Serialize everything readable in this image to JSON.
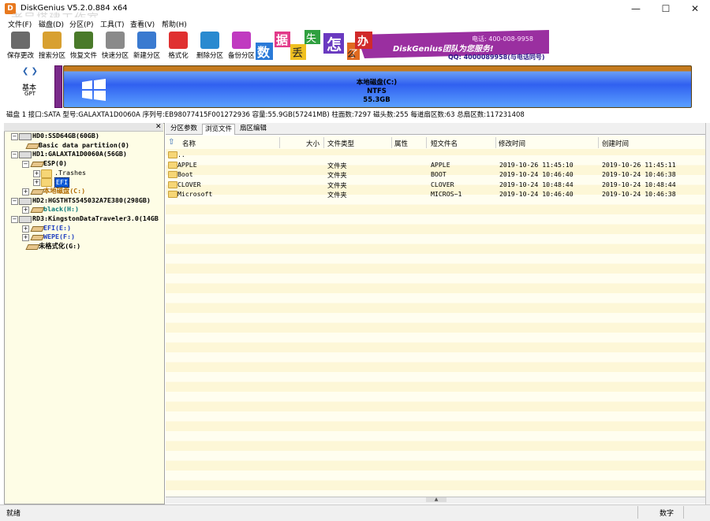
{
  "window": {
    "title": "DiskGenius V5.2.0.884 x64",
    "app_icon_letter": "D",
    "watermark": "老吴搭建工作室"
  },
  "menu": [
    "文件(F)",
    "磁盘(D)",
    "分区(P)",
    "工具(T)",
    "查看(V)",
    "帮助(H)"
  ],
  "toolbar": [
    {
      "label": "保存更改",
      "icon": "save-icon"
    },
    {
      "label": "搜索分区",
      "icon": "search-icon"
    },
    {
      "label": "恢复文件",
      "icon": "recover-icon"
    },
    {
      "label": "快速分区",
      "icon": "quick-partition-icon"
    },
    {
      "label": "新建分区",
      "icon": "new-partition-icon"
    },
    {
      "label": "格式化",
      "icon": "format-icon"
    },
    {
      "label": "删除分区",
      "icon": "delete-icon"
    },
    {
      "label": "备份分区",
      "icon": "backup-icon"
    }
  ],
  "banner": {
    "chars": [
      "数",
      "据",
      "丢",
      "失",
      "了",
      "怎",
      "么",
      "办"
    ],
    "brand": "DiskGenius团队为您服务!",
    "phone": "电话: 400-008-9958",
    "qq": "QQ: 4000089958(与电话同号)"
  },
  "diskmap": {
    "type_label": "基本",
    "scheme": "GPT",
    "partition_name": "本地磁盘(C:)",
    "filesystem": "NTFS",
    "size": "55.3GB"
  },
  "disk_info": "磁盘 1 接口:SATA  型号:GALAXTA1D0060A  序列号:EB98077415F001272936  容量:55.9GB(57241MB)  柱面数:7297  磁头数:255  每道扇区数:63  总扇区数:117231408",
  "tree": [
    {
      "label": "HD0:SSD64GB(60GB)",
      "level": 0,
      "kind": "disk",
      "expander": "−"
    },
    {
      "label": "Basic data partition(0)",
      "level": 1,
      "kind": "partition",
      "expander": ""
    },
    {
      "label": "HD1:GALAXTA1D0060A(56GB)",
      "level": 0,
      "kind": "disk",
      "expander": "−"
    },
    {
      "label": "ESP(0)",
      "level": 1,
      "kind": "partition",
      "expander": "−"
    },
    {
      "label": ".Trashes",
      "level": 2,
      "kind": "folder",
      "expander": "+"
    },
    {
      "label": "EFI",
      "level": 2,
      "kind": "folder",
      "expander": "+",
      "selected": true
    },
    {
      "label": "本地磁盘(C:)",
      "level": 1,
      "kind": "partition",
      "expander": "+",
      "color": "#b06a00"
    },
    {
      "label": "HD2:HGSTHTS545032A7E380(298GB)",
      "level": 0,
      "kind": "disk",
      "expander": "−"
    },
    {
      "label": "black(H:)",
      "level": 1,
      "kind": "partition",
      "expander": "+",
      "color": "#0a7a7a"
    },
    {
      "label": "RD3:KingstonDataTraveler3.0(14GB",
      "level": 0,
      "kind": "disk",
      "expander": "−"
    },
    {
      "label": "EFI(E:)",
      "level": 1,
      "kind": "partition",
      "expander": "+",
      "color": "#2040c0"
    },
    {
      "label": "WEPE(F:)",
      "level": 1,
      "kind": "partition",
      "expander": "+",
      "color": "#2040c0"
    },
    {
      "label": "未格式化(G:)",
      "level": 1,
      "kind": "partition",
      "expander": ""
    }
  ],
  "tabs": [
    "分区参数",
    "浏览文件",
    "扇区编辑"
  ],
  "active_tab": 1,
  "columns": [
    "名称",
    "大小",
    "文件类型",
    "属性",
    "短文件名",
    "修改时间",
    "创建时间"
  ],
  "files": [
    {
      "name": "..",
      "size": "",
      "type": "",
      "attr": "",
      "short": "",
      "modified": "",
      "created": ""
    },
    {
      "name": "APPLE",
      "size": "",
      "type": "文件夹",
      "attr": "",
      "short": "APPLE",
      "modified": "2019-10-26 11:45:10",
      "created": "2019-10-26 11:45:11"
    },
    {
      "name": "Boot",
      "size": "",
      "type": "文件夹",
      "attr": "",
      "short": "BOOT",
      "modified": "2019-10-24 10:46:40",
      "created": "2019-10-24 10:46:38"
    },
    {
      "name": "CLOVER",
      "size": "",
      "type": "文件夹",
      "attr": "",
      "short": "CLOVER",
      "modified": "2019-10-24 10:48:44",
      "created": "2019-10-24 10:48:44"
    },
    {
      "name": "Microsoft",
      "size": "",
      "type": "文件夹",
      "attr": "",
      "short": "MICROS~1",
      "modified": "2019-10-24 10:46:40",
      "created": "2019-10-24 10:46:38"
    }
  ],
  "status": {
    "left": "就绪",
    "right": "数字"
  },
  "colors": {
    "accent": "#2a63b0",
    "partition_ntfs": "#3a6ff0",
    "partition_top": "#c47a1e",
    "list_bg": "#fffef0",
    "banner": "#9a2fa0"
  }
}
